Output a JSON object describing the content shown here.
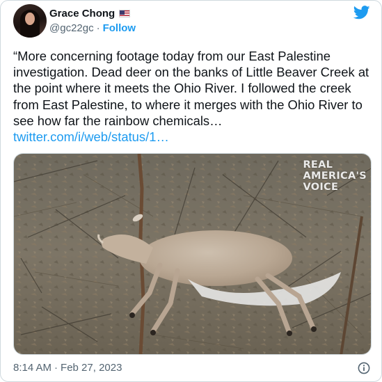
{
  "author": {
    "display_name": "Grace Chong",
    "flag_icon": "us-flag-icon",
    "handle": "@gc22gc",
    "separator": "·",
    "follow_label": "Follow"
  },
  "brand": {
    "icon": "twitter-bird-icon",
    "color": "#1d9bf0"
  },
  "tweet": {
    "text": "“More concerning footage today from our East Palestine investigation. Dead deer on the banks of Little Beaver Creek at the point where it meets the Ohio River. I followed the creek from East Palestine, to where it merges with the Ohio River to see how far the rainbow chemicals…",
    "link": "twitter.com/i/web/status/1…"
  },
  "media": {
    "watermark_line1": "REAL",
    "watermark_line2": "AMERICA'S",
    "watermark_line3": "VOICE"
  },
  "footer": {
    "time": "8:14 AM",
    "separator": "·",
    "date": "Feb 27, 2023",
    "info_icon": "info-icon"
  }
}
